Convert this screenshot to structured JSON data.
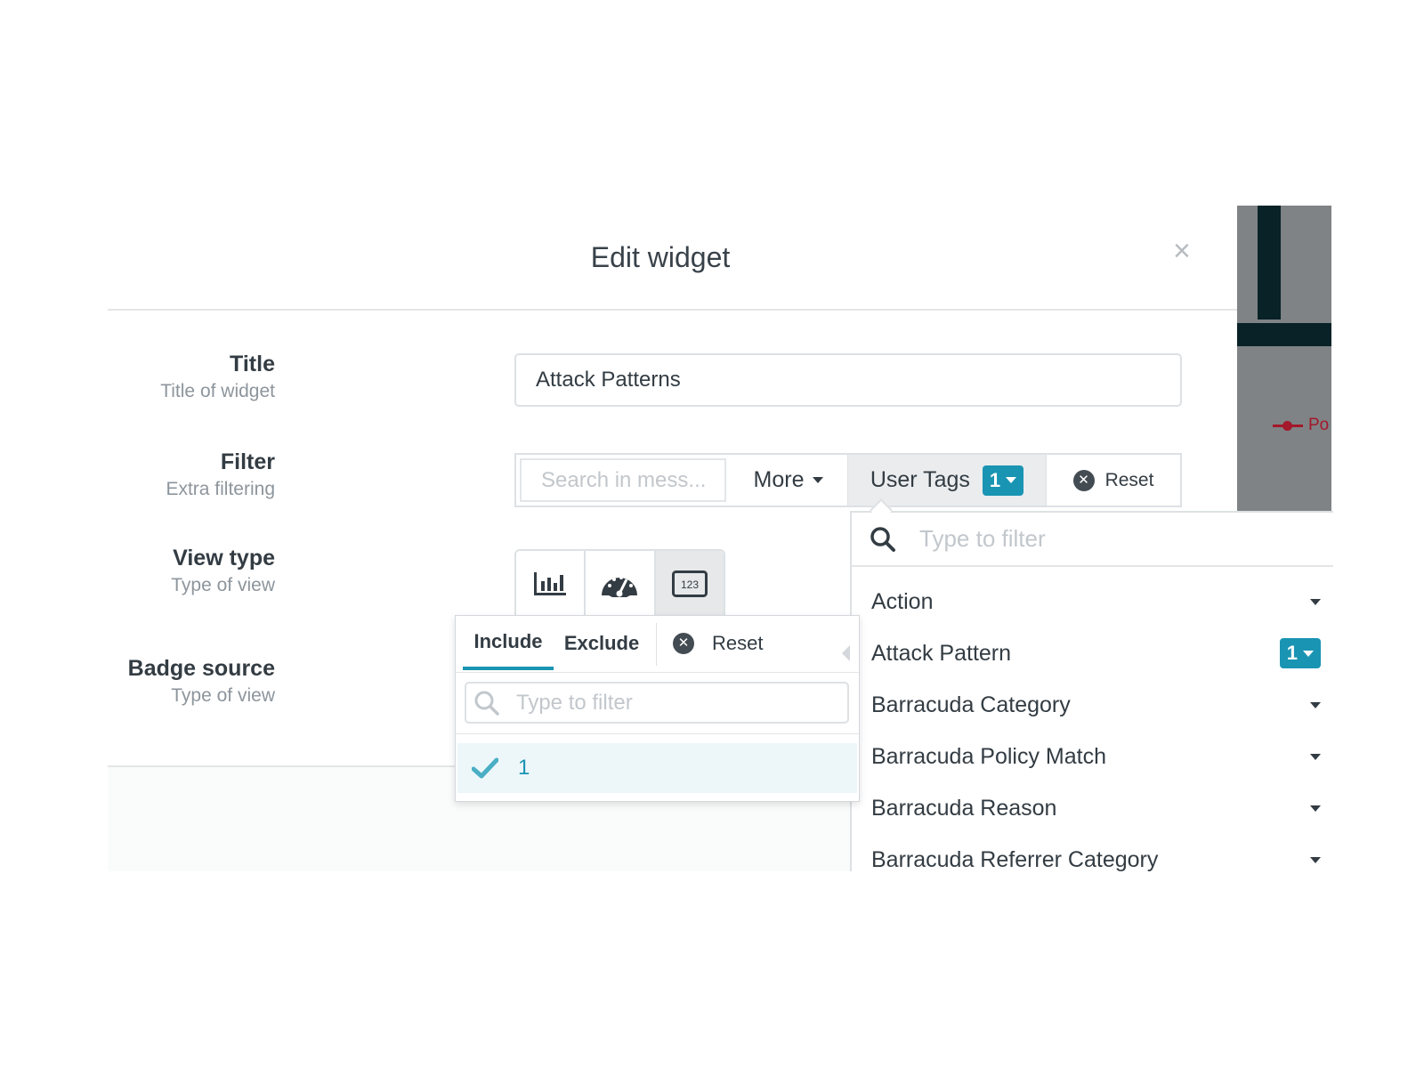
{
  "modal": {
    "title": "Edit widget",
    "close_label": "×"
  },
  "form": {
    "title": {
      "label": "Title",
      "sublabel": "Title of widget",
      "value": "Attack Patterns"
    },
    "filter": {
      "label": "Filter",
      "sublabel": "Extra filtering",
      "search_placeholder": "Search in mess...",
      "more_label": "More",
      "user_tags_label": "User Tags",
      "user_tags_count": "1",
      "reset_label": "Reset"
    },
    "view_type": {
      "label": "View type",
      "sublabel": "Type of view",
      "options": [
        {
          "icon": "bar-chart-icon"
        },
        {
          "icon": "gauge-icon"
        },
        {
          "icon": "number-display-icon",
          "glyph": "123",
          "selected": true
        }
      ]
    },
    "badge_source": {
      "label": "Badge source",
      "sublabel": "Type of view"
    }
  },
  "include_dropdown": {
    "tab_include": "Include",
    "tab_exclude": "Exclude",
    "reset_label": "Reset",
    "search_placeholder": "Type to filter",
    "items": [
      {
        "label": "1",
        "checked": true
      }
    ]
  },
  "tag_dropdown": {
    "search_placeholder": "Type to filter",
    "items": [
      {
        "label": "Action"
      },
      {
        "label": "Attack Pattern",
        "count": "1"
      },
      {
        "label": "Barracuda Category"
      },
      {
        "label": "Barracuda Policy Match"
      },
      {
        "label": "Barracuda Reason"
      },
      {
        "label": "Barracuda Referrer Category"
      }
    ]
  },
  "background_chart": {
    "legend_label": "Po",
    "legend_color": "#a3182a"
  },
  "colors": {
    "accent": "#1a94b3",
    "text": "#333c43",
    "muted": "#8d959c"
  }
}
